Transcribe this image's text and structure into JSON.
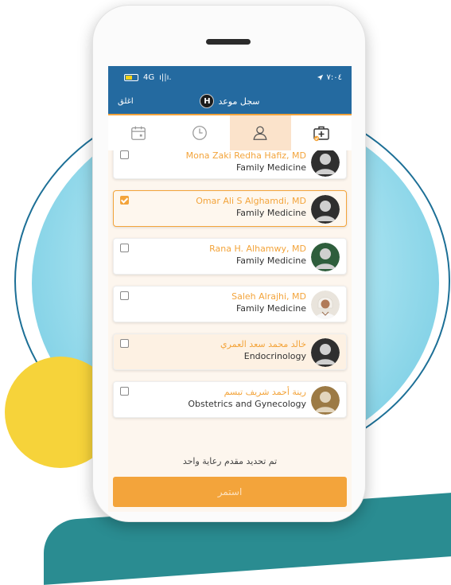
{
  "status": {
    "network": "4G",
    "signal": "ı||ı.",
    "time": "٧:٠٤"
  },
  "appbar": {
    "close_label": "اغلق",
    "title": "سجل موعد",
    "badge": "H"
  },
  "tabs": [
    {
      "icon": "calendar-icon",
      "active": false
    },
    {
      "icon": "clock-icon",
      "active": false
    },
    {
      "icon": "user-icon",
      "active": true
    },
    {
      "icon": "medical-kit-icon",
      "active": false
    }
  ],
  "doctors": [
    {
      "name": "Mona Zaki Redha Hafiz, MD",
      "specialty": "Family Medicine",
      "checked": false
    },
    {
      "name": "Omar Ali S Alghamdi, MD",
      "specialty": "Family Medicine",
      "checked": true
    },
    {
      "name": "Rana H. Alhamwy, MD",
      "specialty": "Family Medicine",
      "checked": false
    },
    {
      "name": "Saleh Alrajhi, MD",
      "specialty": "Family Medicine",
      "checked": false
    },
    {
      "name": "خالد محمد سعد العمري",
      "specialty": "Endocrinology",
      "checked": false
    },
    {
      "name": "رينة أحمد شريف تبسم",
      "specialty": "Obstetrics and Gynecology",
      "checked": false
    }
  ],
  "note": "تم تحديد مقدم رعاية واحد",
  "continue_label": "استمر",
  "colors": {
    "primary": "#246aa0",
    "accent": "#f3a43b",
    "background": "#fdf6ee"
  }
}
